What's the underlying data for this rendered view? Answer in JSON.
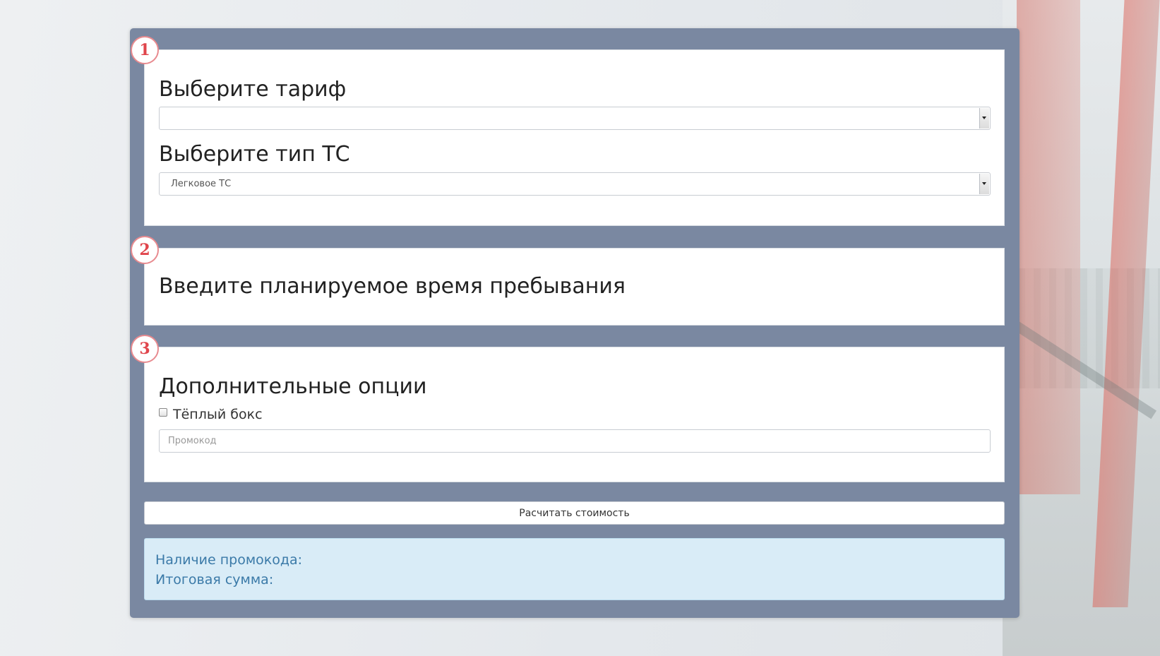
{
  "steps": [
    {
      "number": "1"
    },
    {
      "number": "2"
    },
    {
      "number": "3"
    }
  ],
  "tariff": {
    "heading": "Выберите тариф",
    "selected": ""
  },
  "vehicle": {
    "heading": "Выберите тип ТС",
    "selected": "Легковое ТС"
  },
  "stay": {
    "heading": "Введите планируемое время пребывания"
  },
  "options": {
    "heading": "Дополнительные опции",
    "warm_box_label": "Тёплый бокс",
    "warm_box_checked": false,
    "promo_placeholder": "Промокод",
    "promo_value": ""
  },
  "calculate_button": "Расчитать стоимость",
  "result": {
    "promo_label": "Наличие промокода:",
    "total_label": "Итоговая сумма:"
  },
  "colors": {
    "panel": "#7a88a1",
    "badge_border": "#e88a8f",
    "badge_text": "#e0454c",
    "result_bg": "#d9ecf7",
    "result_text": "#3b7aa8"
  }
}
